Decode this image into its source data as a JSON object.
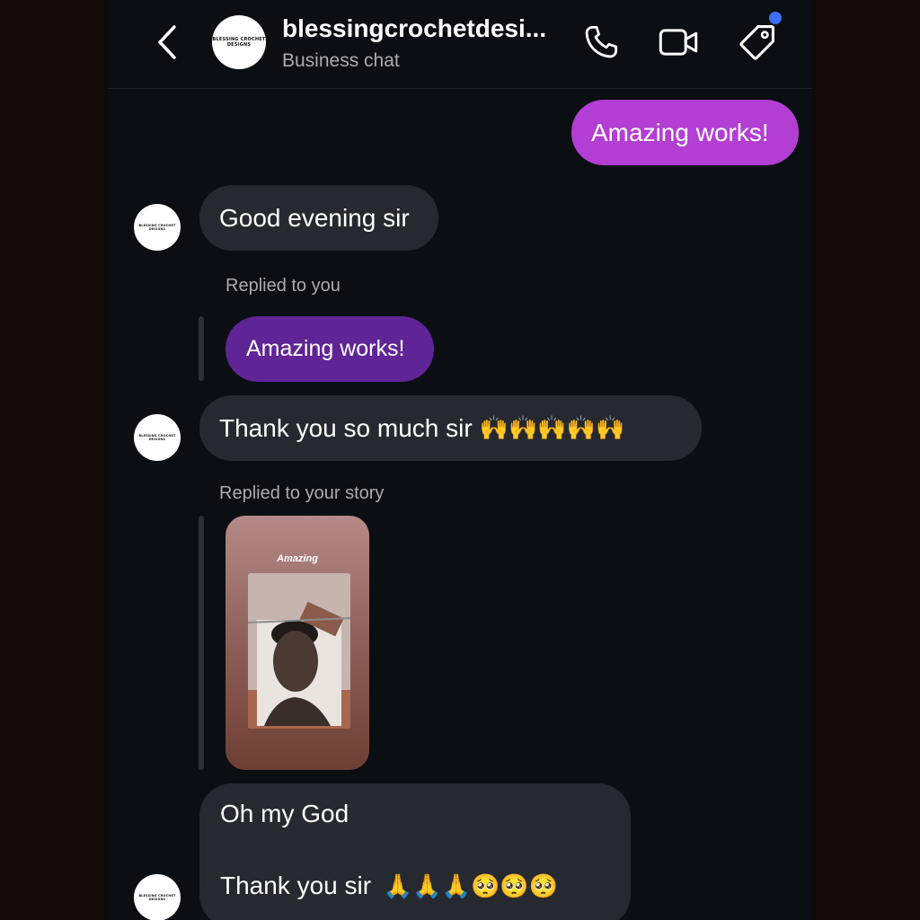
{
  "header": {
    "title": "blessingcrochetdesi...",
    "subtitle": "Business chat",
    "avatar_logo": "BLESSING CROCHET DESIGNS"
  },
  "messages": [
    {
      "from": "me",
      "text": "Amazing works!"
    },
    {
      "from": "them",
      "text": "Good evening sir"
    },
    {
      "from": "them",
      "reply_label": "Replied to you",
      "quoted": "Amazing works!",
      "text": "Thank you so much sir",
      "emoji": "🙌🙌🙌🙌🙌"
    },
    {
      "from": "them",
      "reply_label": "Replied to your story",
      "story_caption": "Amazing",
      "line1": "Oh my God",
      "line2": "Thank you sir",
      "emoji": "🙏🙏🙏🥺🥺🥺"
    }
  ],
  "colors": {
    "outgoing_bubble": "#b33ed3",
    "incoming_bubble": "#262a30",
    "quoted_bubble": "#5f2496",
    "notification_dot": "#3e6ef5",
    "background": "#0b0e12"
  },
  "icons": [
    "chevron-left-icon",
    "phone-icon",
    "video-camera-icon",
    "tag-icon"
  ]
}
